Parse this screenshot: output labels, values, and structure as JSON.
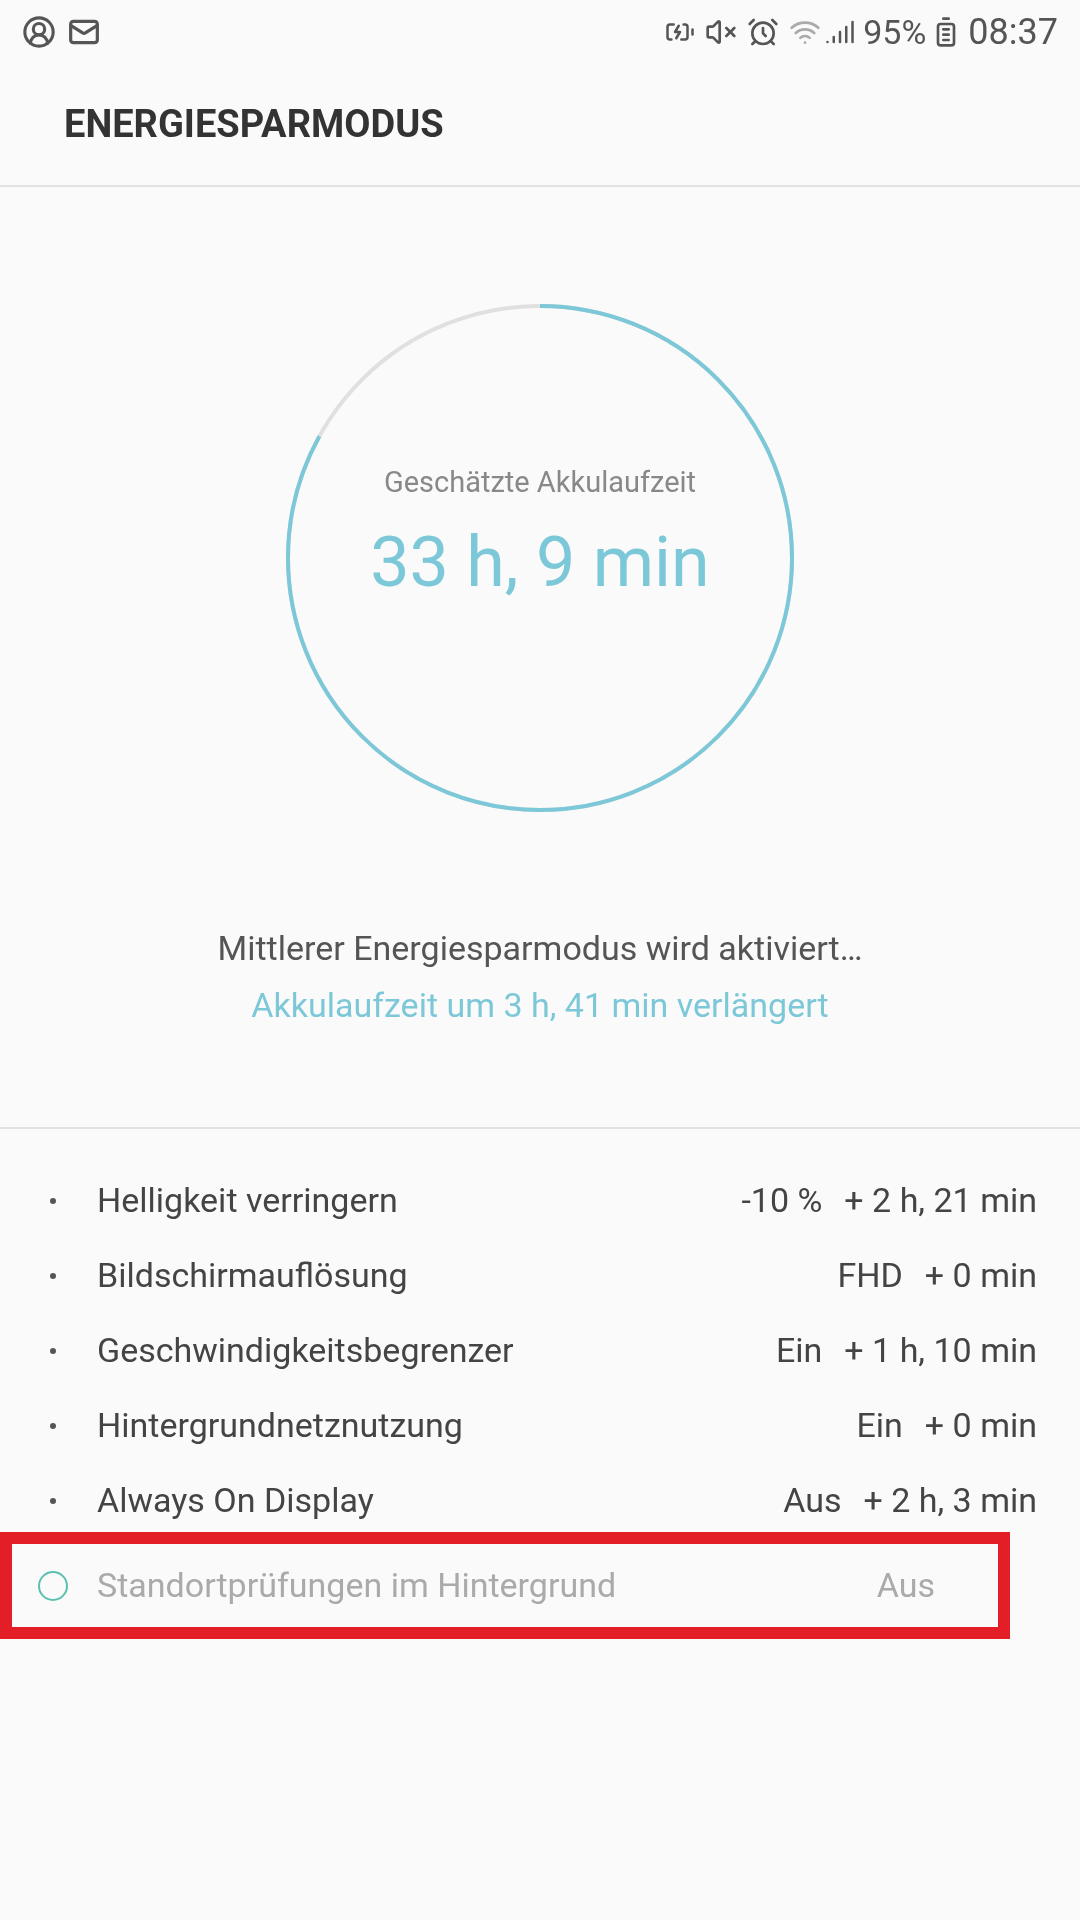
{
  "status_bar": {
    "battery_percent": "95%",
    "time": "08:37"
  },
  "header": {
    "title": "ENERGIESPARMODUS"
  },
  "estimate": {
    "label": "Geschätzte Akkulaufzeit",
    "value": "33 h, 9 min"
  },
  "message": {
    "status": "Mittlerer Energiesparmodus wird aktiviert…",
    "gain": "Akkulaufzeit um 3 h, 41 min verlängert"
  },
  "settings": [
    {
      "kind": "bullet",
      "name": "Helligkeit verringern",
      "value": "-10 %",
      "delta": "+ 2 h, 21 min",
      "highlighted": false
    },
    {
      "kind": "bullet",
      "name": "Bildschirmauflösung",
      "value": "FHD",
      "delta": "+ 0 min",
      "highlighted": false
    },
    {
      "kind": "bullet",
      "name": "Geschwindigkeitsbegrenzer",
      "value": "Ein",
      "delta": "+ 1 h, 10 min",
      "highlighted": false
    },
    {
      "kind": "bullet",
      "name": "Hintergrundnetznutzung",
      "value": "Ein",
      "delta": "+ 0 min",
      "highlighted": false
    },
    {
      "kind": "bullet",
      "name": "Always On Display",
      "value": "Aus",
      "delta": "+ 2 h, 3 min",
      "highlighted": false
    },
    {
      "kind": "pending",
      "name": "Standortprüfungen im Hintergrund",
      "value": "Aus",
      "highlighted": true
    }
  ]
}
